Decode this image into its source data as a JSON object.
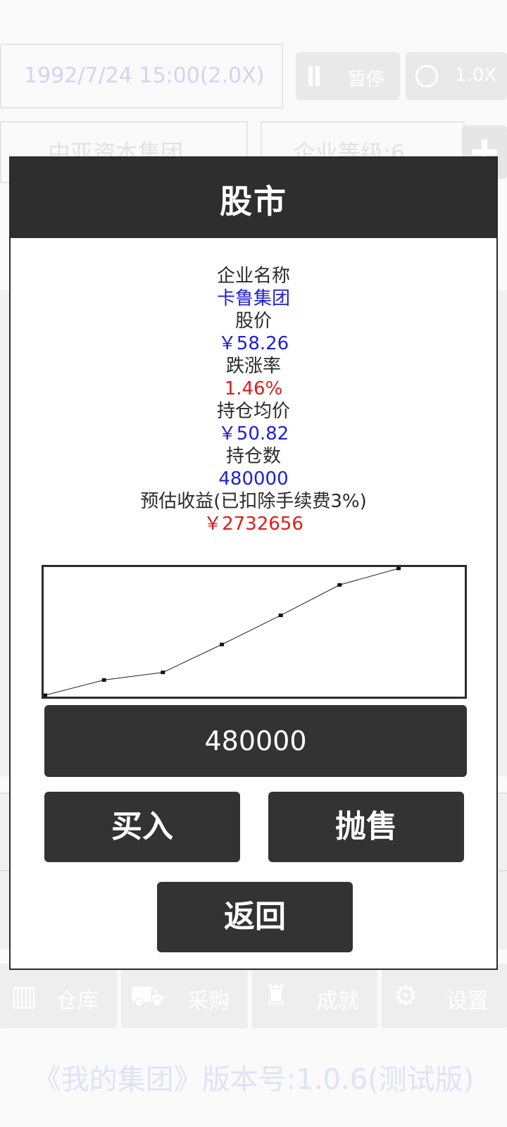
{
  "background": {
    "datetime": "1992/7/24 15:00(2.0X)",
    "pause_label": "暂停",
    "speed_label": "1.0X",
    "company_name": "中亚资本集团",
    "company_level": "企业等级:6",
    "nav": [
      {
        "icon": "map-icon",
        "label": "仓库"
      },
      {
        "icon": "cart-icon",
        "label": "采购"
      },
      {
        "icon": "trophy-icon",
        "label": "成就"
      },
      {
        "icon": "gear-icon",
        "label": "设置"
      }
    ],
    "footer": "《我的集团》版本号:1.0.6(测试版)"
  },
  "dialog": {
    "title": "股市",
    "company_label": "企业名称",
    "company_value": "卡鲁集团",
    "price_label": "股价",
    "price_value": "￥58.26",
    "change_label": "跌涨率",
    "change_value": "1.46%",
    "avg_cost_label": "持仓均价",
    "avg_cost_value": "￥50.82",
    "holdings_label": "持仓数",
    "holdings_value": "480000",
    "profit_label": "预估收益(已扣除手续费3%)",
    "profit_value": "￥2732656",
    "quantity_input": "480000",
    "buy_label": "买入",
    "sell_label": "抛售",
    "back_label": "返回"
  },
  "colors": {
    "accent_blue": "#1f1fd6",
    "accent_red": "#e01b1b",
    "button_dark": "#333333"
  },
  "chart_data": {
    "type": "line",
    "title": "",
    "xlabel": "",
    "ylabel": "",
    "x": [
      0,
      1,
      2,
      3,
      4,
      5,
      6
    ],
    "values": [
      0.0,
      0.12,
      0.18,
      0.4,
      0.63,
      0.87,
      1.0
    ],
    "ylim": [
      0,
      1
    ],
    "grid": false
  }
}
